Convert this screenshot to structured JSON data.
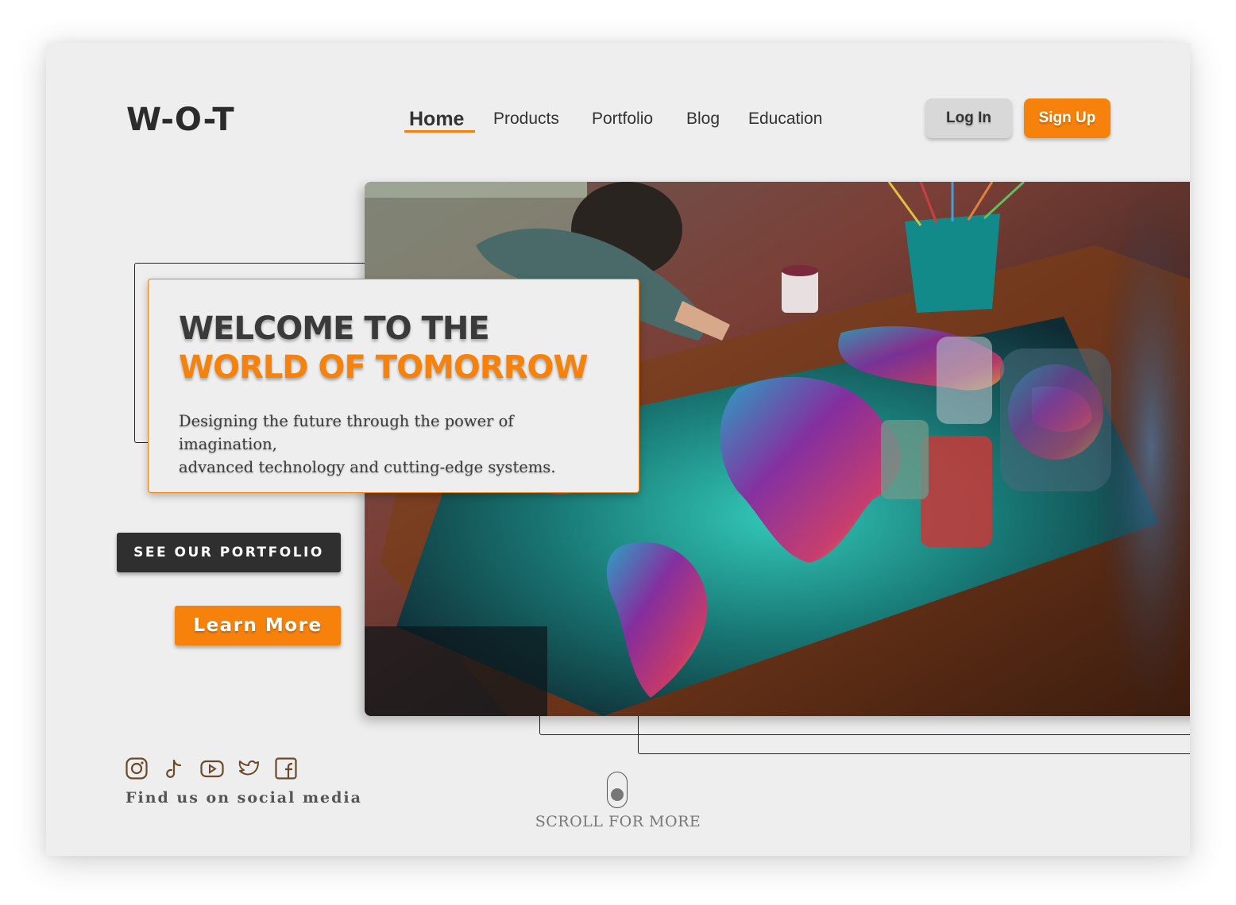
{
  "brand": {
    "logo": "W-O-T",
    "accent": "#f6820c",
    "dark": "#2f2f2f"
  },
  "nav": {
    "items": [
      {
        "label": "Home",
        "active": true
      },
      {
        "label": "Products"
      },
      {
        "label": "Portfolio"
      },
      {
        "label": "Blog"
      },
      {
        "label": "Education"
      }
    ]
  },
  "auth": {
    "login_label": "Log In",
    "signup_label": "Sign Up"
  },
  "hero": {
    "title_line1": "WELCOME TO THE",
    "title_line2": "WORLD OF TOMORROW",
    "description_line1": "Designing the future through the power of imagination,",
    "description_line2": "advanced technology and cutting-edge systems.",
    "image_subject": "artist painting a glowing world map on a desk"
  },
  "cta": {
    "portfolio_label": "SEE OUR PORTFOLIO",
    "learn_label": "Learn More"
  },
  "social": {
    "icons": [
      "instagram-icon",
      "tiktok-icon",
      "youtube-icon",
      "twitter-icon",
      "facebook-icon"
    ],
    "caption": "Find us on social media"
  },
  "scroll": {
    "label": "SCROLL FOR MORE"
  }
}
